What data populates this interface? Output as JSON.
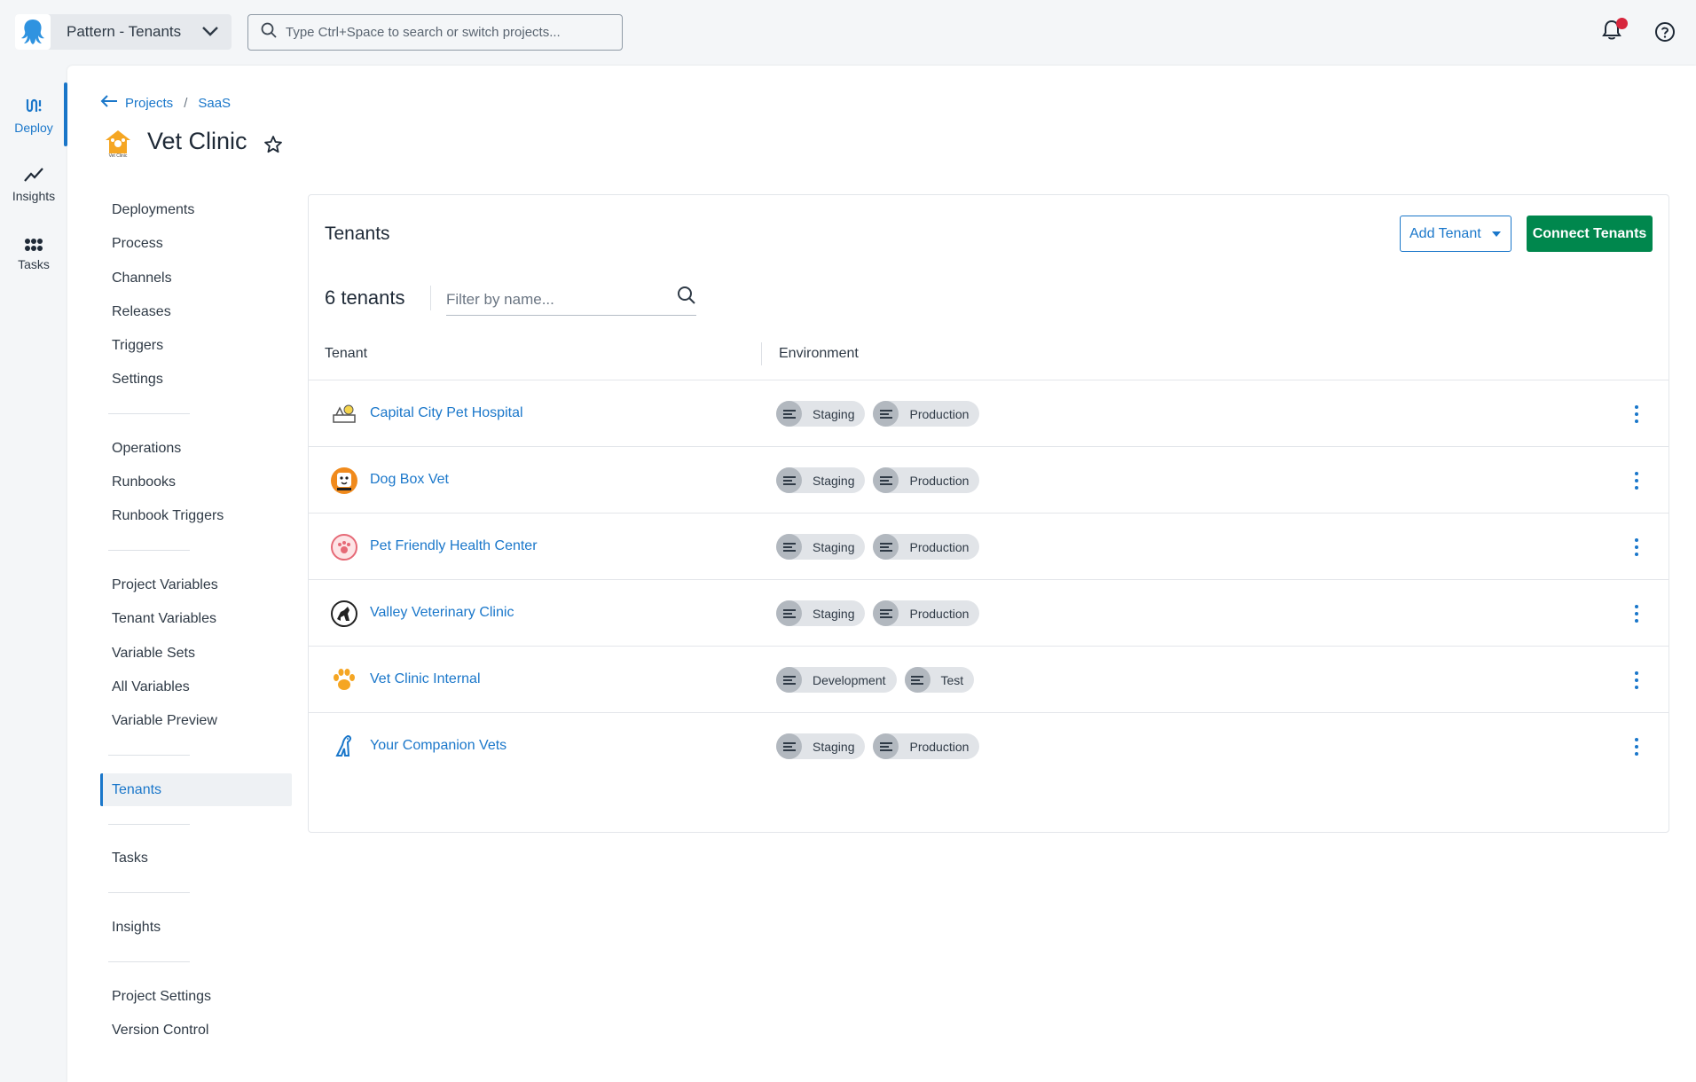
{
  "topbar": {
    "space_name": "Pattern - Tenants",
    "search_placeholder": "Type Ctrl+Space to search or switch projects..."
  },
  "rail": {
    "items": [
      {
        "label": "Deploy",
        "icon": "deploy-icon",
        "active": true
      },
      {
        "label": "Insights",
        "icon": "insights-icon"
      },
      {
        "label": "Tasks",
        "icon": "tasks-icon"
      }
    ]
  },
  "breadcrumb": {
    "projects": "Projects",
    "group": "SaaS"
  },
  "project": {
    "title": "Vet Clinic"
  },
  "nav": {
    "deployments": "Deployments",
    "process": "Process",
    "channels": "Channels",
    "releases": "Releases",
    "triggers": "Triggers",
    "settings": "Settings",
    "operations": "Operations",
    "runbooks": "Runbooks",
    "runbook_triggers": "Runbook Triggers",
    "project_variables": "Project Variables",
    "tenant_variables": "Tenant Variables",
    "variable_sets": "Variable Sets",
    "all_variables": "All Variables",
    "variable_preview": "Variable Preview",
    "tenants": "Tenants",
    "tasks": "Tasks",
    "insights": "Insights",
    "project_settings": "Project Settings",
    "version_control": "Version Control"
  },
  "tenants_card": {
    "title": "Tenants",
    "add_button": "Add Tenant",
    "connect_button": "Connect Tenants",
    "count": "6 tenants",
    "filter_placeholder": "Filter by name...",
    "columns": {
      "tenant": "Tenant",
      "environment": "Environment"
    },
    "rows": [
      {
        "name": "Capital City Pet Hospital",
        "envs": [
          "Staging",
          "Production"
        ]
      },
      {
        "name": "Dog Box Vet",
        "envs": [
          "Staging",
          "Production"
        ]
      },
      {
        "name": "Pet Friendly Health Center",
        "envs": [
          "Staging",
          "Production"
        ]
      },
      {
        "name": "Valley Veterinary Clinic",
        "envs": [
          "Staging",
          "Production"
        ]
      },
      {
        "name": "Vet Clinic Internal",
        "envs": [
          "Development",
          "Test"
        ]
      },
      {
        "name": "Your Companion Vets",
        "envs": [
          "Staging",
          "Production"
        ]
      }
    ]
  },
  "colors": {
    "accent": "#1a77ca",
    "primary_button": "#00874d",
    "notification_dot": "#d7263d"
  }
}
